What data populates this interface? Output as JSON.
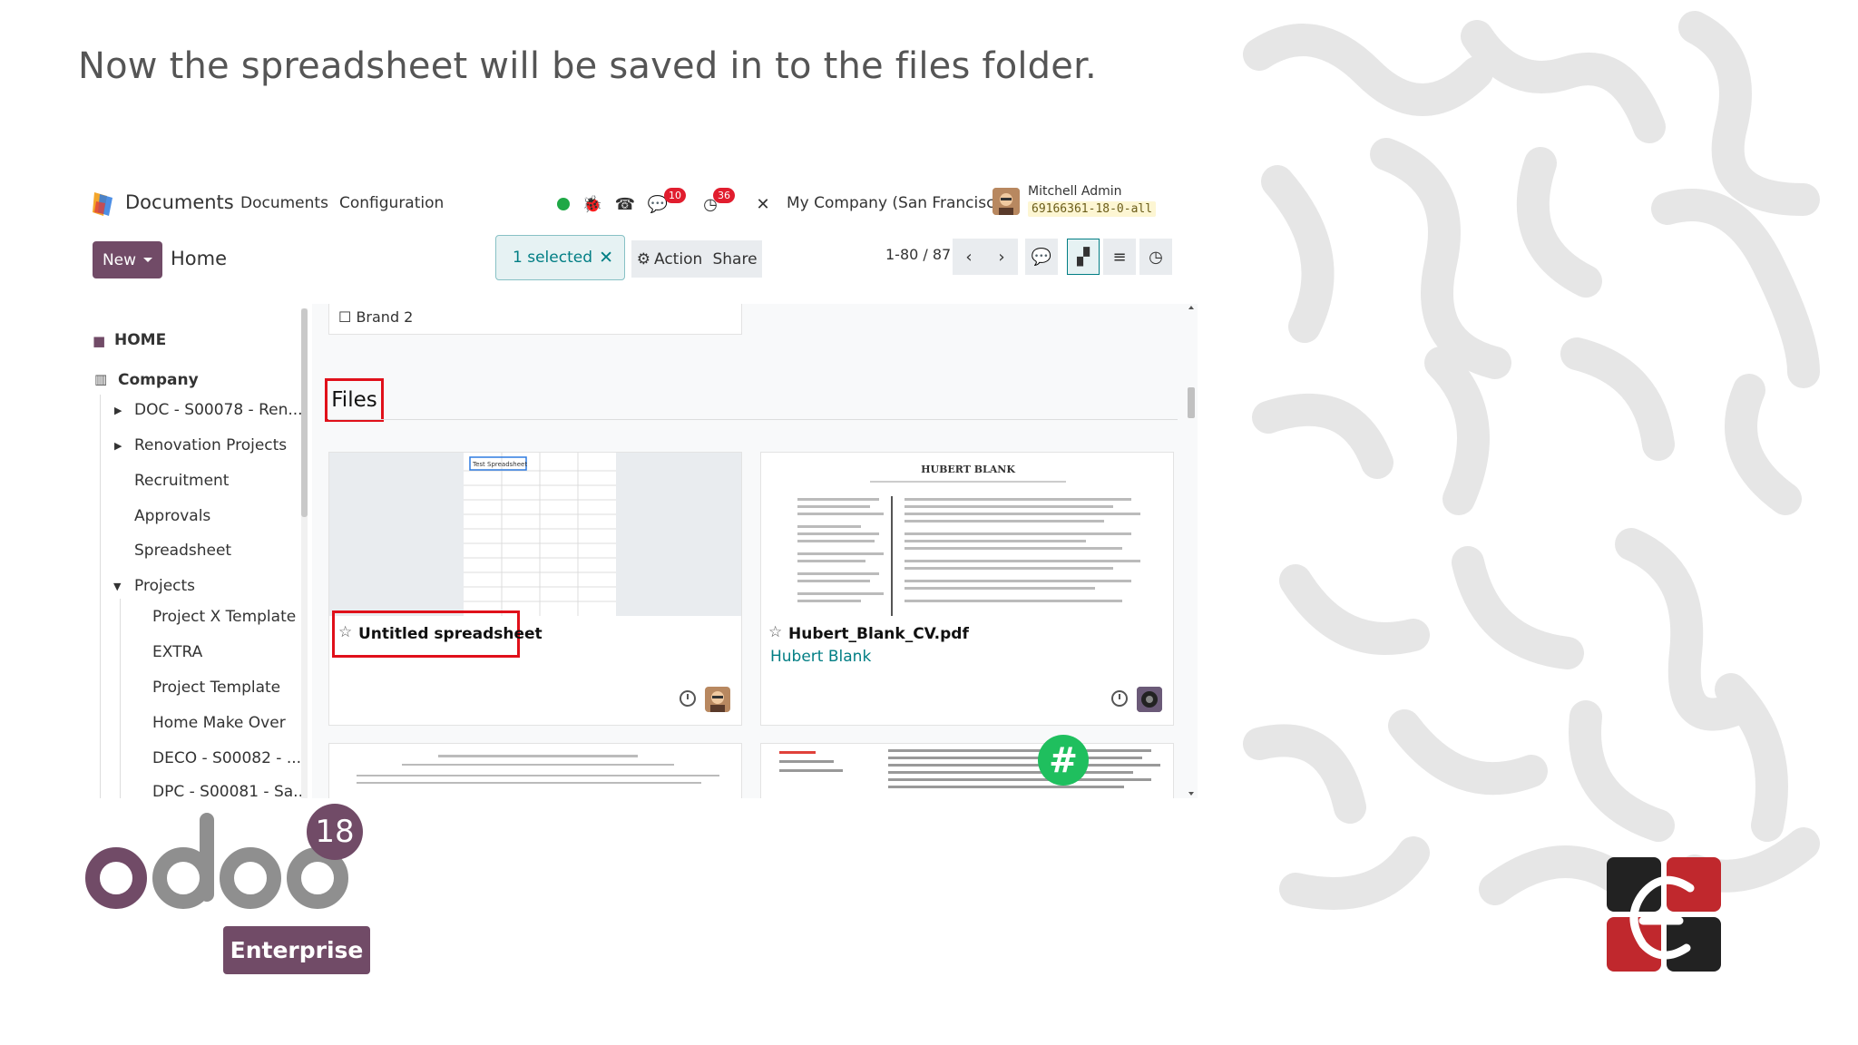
{
  "slide": {
    "title": "Now the spreadsheet will be saved in to the files folder."
  },
  "topbar": {
    "app_name": "Documents",
    "menu": [
      "Documents",
      "Configuration"
    ],
    "messages_count": "10",
    "activities_count": "36",
    "company": "My Company (San Francisco)",
    "user_name": "Mitchell Admin",
    "db_name": "69166361-18-0-all"
  },
  "control_panel": {
    "new_label": "New",
    "breadcrumb": "Home",
    "selected_label": "1 selected",
    "action_label": "Action",
    "share_label": "Share",
    "pager": "1-80 / 87"
  },
  "sidebar": {
    "home": "HOME",
    "company": "Company",
    "items": [
      {
        "label": "DOC - S00078 - Ren..."
      },
      {
        "label": "Renovation Projects"
      },
      {
        "label": "Recruitment"
      },
      {
        "label": "Approvals"
      },
      {
        "label": "Spreadsheet"
      },
      {
        "label": "Projects"
      },
      {
        "label": "Project X Template"
      },
      {
        "label": "EXTRA"
      },
      {
        "label": "Project Template"
      },
      {
        "label": "Home Make Over"
      },
      {
        "label": "DECO - S00082 - ..."
      },
      {
        "label": "DPC - S00081 - Sa..."
      }
    ]
  },
  "content": {
    "folder_card": "Brand 2",
    "section_title": "Files",
    "cards": [
      {
        "title": "Untitled spreadsheet",
        "thumb_label": "Test Spreadsheet",
        "owner": ""
      },
      {
        "title": "Hubert_Blank_CV.pdf",
        "owner": "Hubert Blank",
        "thumb_heading": "HUBERT BLANK"
      }
    ],
    "fab_symbol": "#"
  },
  "branding": {
    "version": "18",
    "edition": "Enterprise"
  },
  "colors": {
    "brand": "#714b67",
    "teal": "#017e84",
    "highlight": "#e0101a",
    "fab": "#1fbf5e"
  }
}
